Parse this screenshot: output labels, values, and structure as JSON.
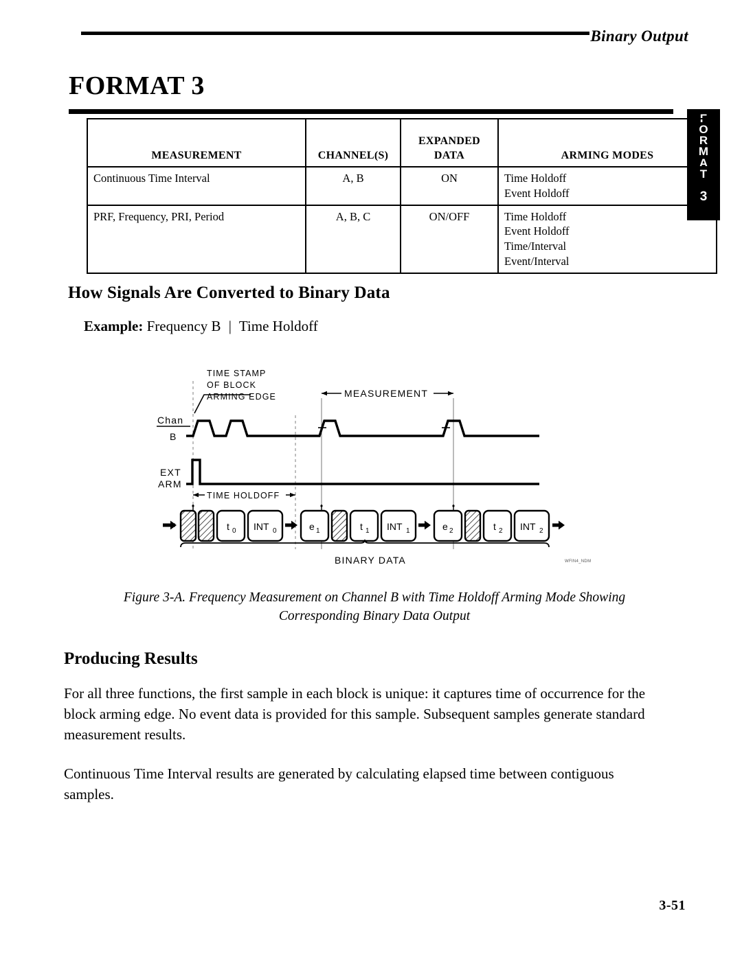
{
  "header": {
    "running_title": "Binary Output"
  },
  "page_title": "FORMAT 3",
  "thumb_tab": {
    "letters": [
      "F",
      "O",
      "R",
      "M",
      "A",
      "T"
    ],
    "number": "3"
  },
  "spec_table": {
    "headers": [
      {
        "line1": "MEASUREMENT",
        "line2": ""
      },
      {
        "line1": "CHANNEL(S)",
        "line2": ""
      },
      {
        "line1": "EXPANDED",
        "line2": "DATA"
      },
      {
        "line1": "ARMING MODES",
        "line2": ""
      }
    ],
    "rows": [
      {
        "measurement": "Continuous Time Interval",
        "channels": "A, B",
        "expanded_data": "ON",
        "arming_modes": [
          "Time Holdoff",
          "Event Holdoff"
        ]
      },
      {
        "measurement": "PRF, Frequency, PRI, Period",
        "channels": "A, B, C",
        "expanded_data": "ON/OFF",
        "arming_modes": [
          "Time Holdoff",
          "Event Holdoff",
          "Time/Interval",
          "Event/Interval"
        ]
      }
    ]
  },
  "sections": {
    "signals_heading": "How Signals Are Converted to Binary Data",
    "example_label": "Example:",
    "example_value_left": "Frequency B",
    "example_separator": "|",
    "example_value_right": "Time Holdoff",
    "producing_heading": "Producing Results",
    "paragraph_1": "For all three functions, the first sample in each block is unique: it captures time of occurrence for the block arming edge. No event data is provided for this sample. Subsequent samples generate standard measurement results.",
    "paragraph_2": "Continuous Time Interval results are generated by calculating elapsed time between contiguous samples."
  },
  "figure": {
    "callout_line1": "TIME STAMP",
    "callout_line2": "OF BLOCK",
    "callout_line3": "ARMING EDGE",
    "measurement_label": "MEASUREMENT",
    "channel_label_line1": "Chan",
    "channel_label_line2": "B",
    "ext_arm_line1": "EXT",
    "ext_arm_line2": "ARM",
    "time_holdoff_label": "TIME HOLDOFF",
    "binary_data_label": "BINARY DATA",
    "artifact_label": "WFIN4_NDM",
    "blocks": [
      {
        "type": "hatched",
        "label": "",
        "sub": ""
      },
      {
        "type": "hatched",
        "label": "",
        "sub": ""
      },
      {
        "type": "plain",
        "label": "t",
        "sub": "0"
      },
      {
        "type": "plain",
        "label": "INT",
        "sub": "0"
      },
      {
        "type": "arrow",
        "label": "",
        "sub": ""
      },
      {
        "type": "plain",
        "label": "e",
        "sub": "1"
      },
      {
        "type": "hatched",
        "label": "",
        "sub": ""
      },
      {
        "type": "plain",
        "label": "t",
        "sub": "1"
      },
      {
        "type": "plain",
        "label": "INT",
        "sub": "1"
      },
      {
        "type": "arrow",
        "label": "",
        "sub": ""
      },
      {
        "type": "plain",
        "label": "e",
        "sub": "2"
      },
      {
        "type": "hatched",
        "label": "",
        "sub": ""
      },
      {
        "type": "plain",
        "label": "t",
        "sub": "2"
      },
      {
        "type": "plain",
        "label": "INT",
        "sub": "2"
      }
    ]
  },
  "caption": {
    "line1": "Figure 3-A. Frequency Measurement on Channel B with Time Holdoff Arming Mode Showing",
    "line2": "Corresponding Binary Data Output"
  },
  "page_number": "3-51"
}
